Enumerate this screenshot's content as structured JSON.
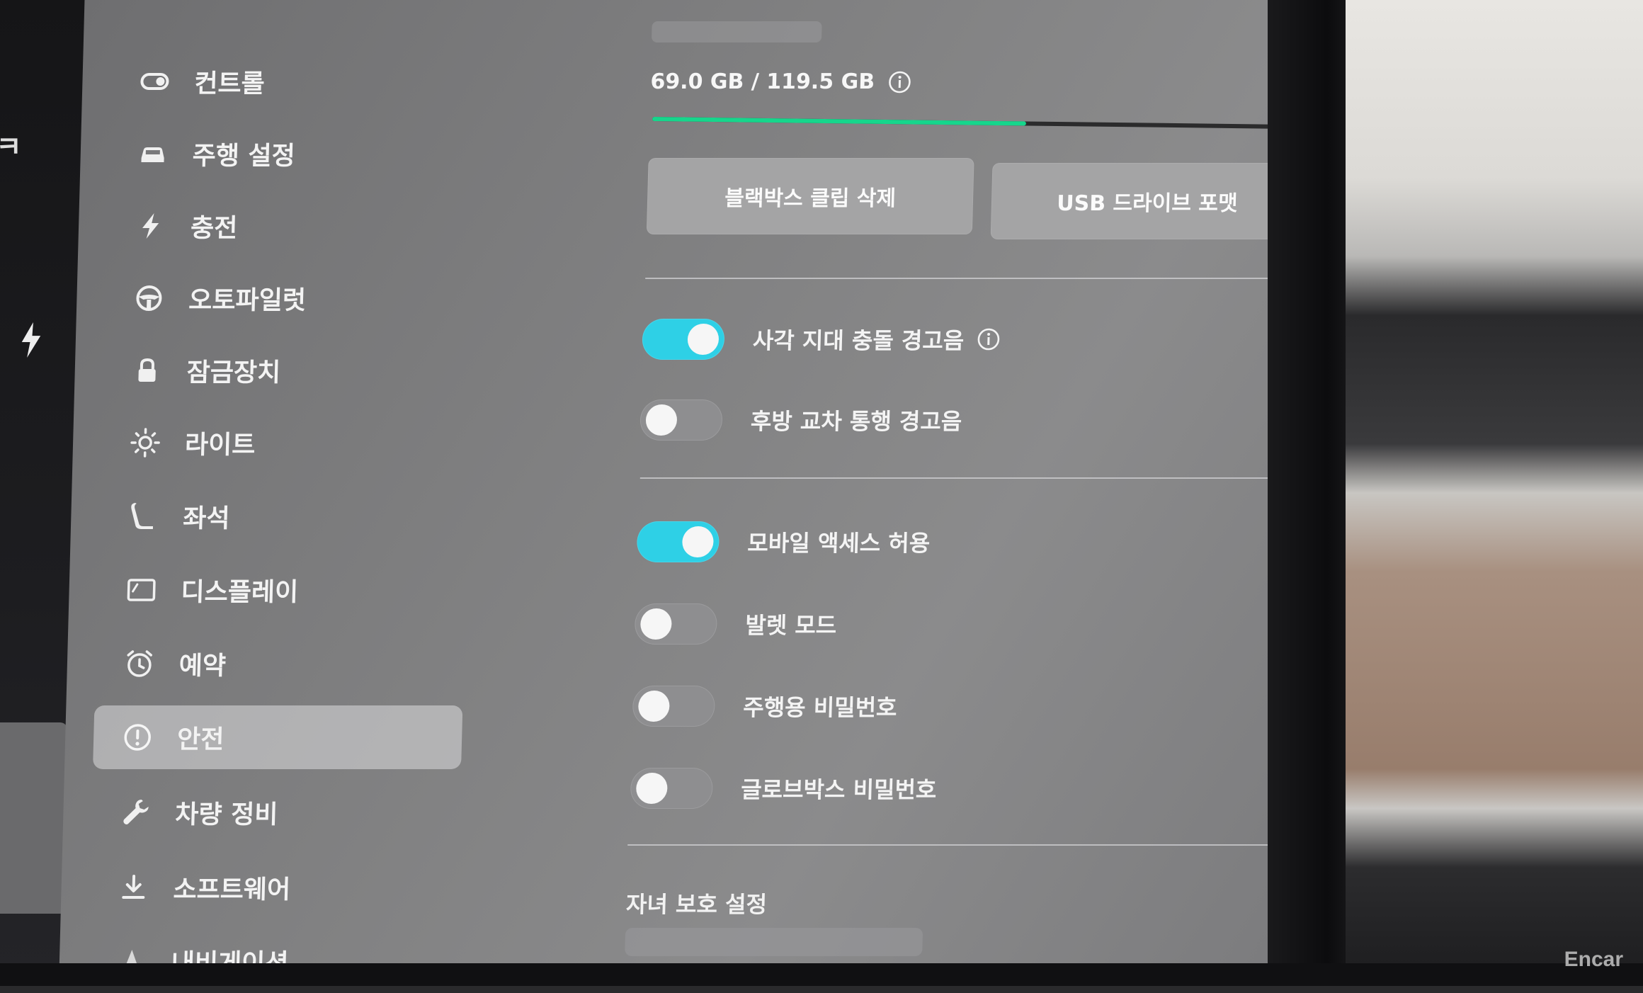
{
  "sidebar": {
    "items": [
      {
        "label": "컨트롤",
        "icon": "toggle-icon"
      },
      {
        "label": "주행 설정",
        "icon": "car-icon"
      },
      {
        "label": "충전",
        "icon": "bolt-icon"
      },
      {
        "label": "오토파일럿",
        "icon": "steering-wheel-icon"
      },
      {
        "label": "잠금장치",
        "icon": "lock-icon"
      },
      {
        "label": "라이트",
        "icon": "light-icon"
      },
      {
        "label": "좌석",
        "icon": "seat-icon"
      },
      {
        "label": "디스플레이",
        "icon": "display-icon"
      },
      {
        "label": "예약",
        "icon": "alarm-clock-icon"
      },
      {
        "label": "안전",
        "icon": "alert-circle-icon"
      },
      {
        "label": "차량 정비",
        "icon": "wrench-icon"
      },
      {
        "label": "소프트웨어",
        "icon": "download-icon"
      },
      {
        "label": "내비게이션",
        "icon": "navigation-arrow-icon"
      }
    ],
    "active": "안전"
  },
  "storage": {
    "text": "69.0 GB / 119.5 GB",
    "used_fraction": 0.577,
    "progress_color": "#16d68c"
  },
  "buttons": {
    "delete_clips": "블랙박스 클립 삭제",
    "format_usb": "USB 드라이브 포맷"
  },
  "settings": [
    {
      "label": "사각 지대 충돌 경고음",
      "on": true,
      "info": true
    },
    {
      "label": "후방 교차 통행 경고음",
      "on": false,
      "info": false
    },
    {
      "label": "모바일 액세스 허용",
      "on": true,
      "info": false
    },
    {
      "label": "발렛 모드",
      "on": false,
      "info": false
    },
    {
      "label": "주행용 비밀번호",
      "on": false,
      "info": false
    },
    {
      "label": "글로브박스 비밀번호",
      "on": false,
      "info": false
    }
  ],
  "section_heading": "자녀 보호 설정",
  "colors": {
    "toggle_on": "#2ed0e6",
    "toggle_off": "#8e8e90"
  },
  "watermark": "Encar"
}
